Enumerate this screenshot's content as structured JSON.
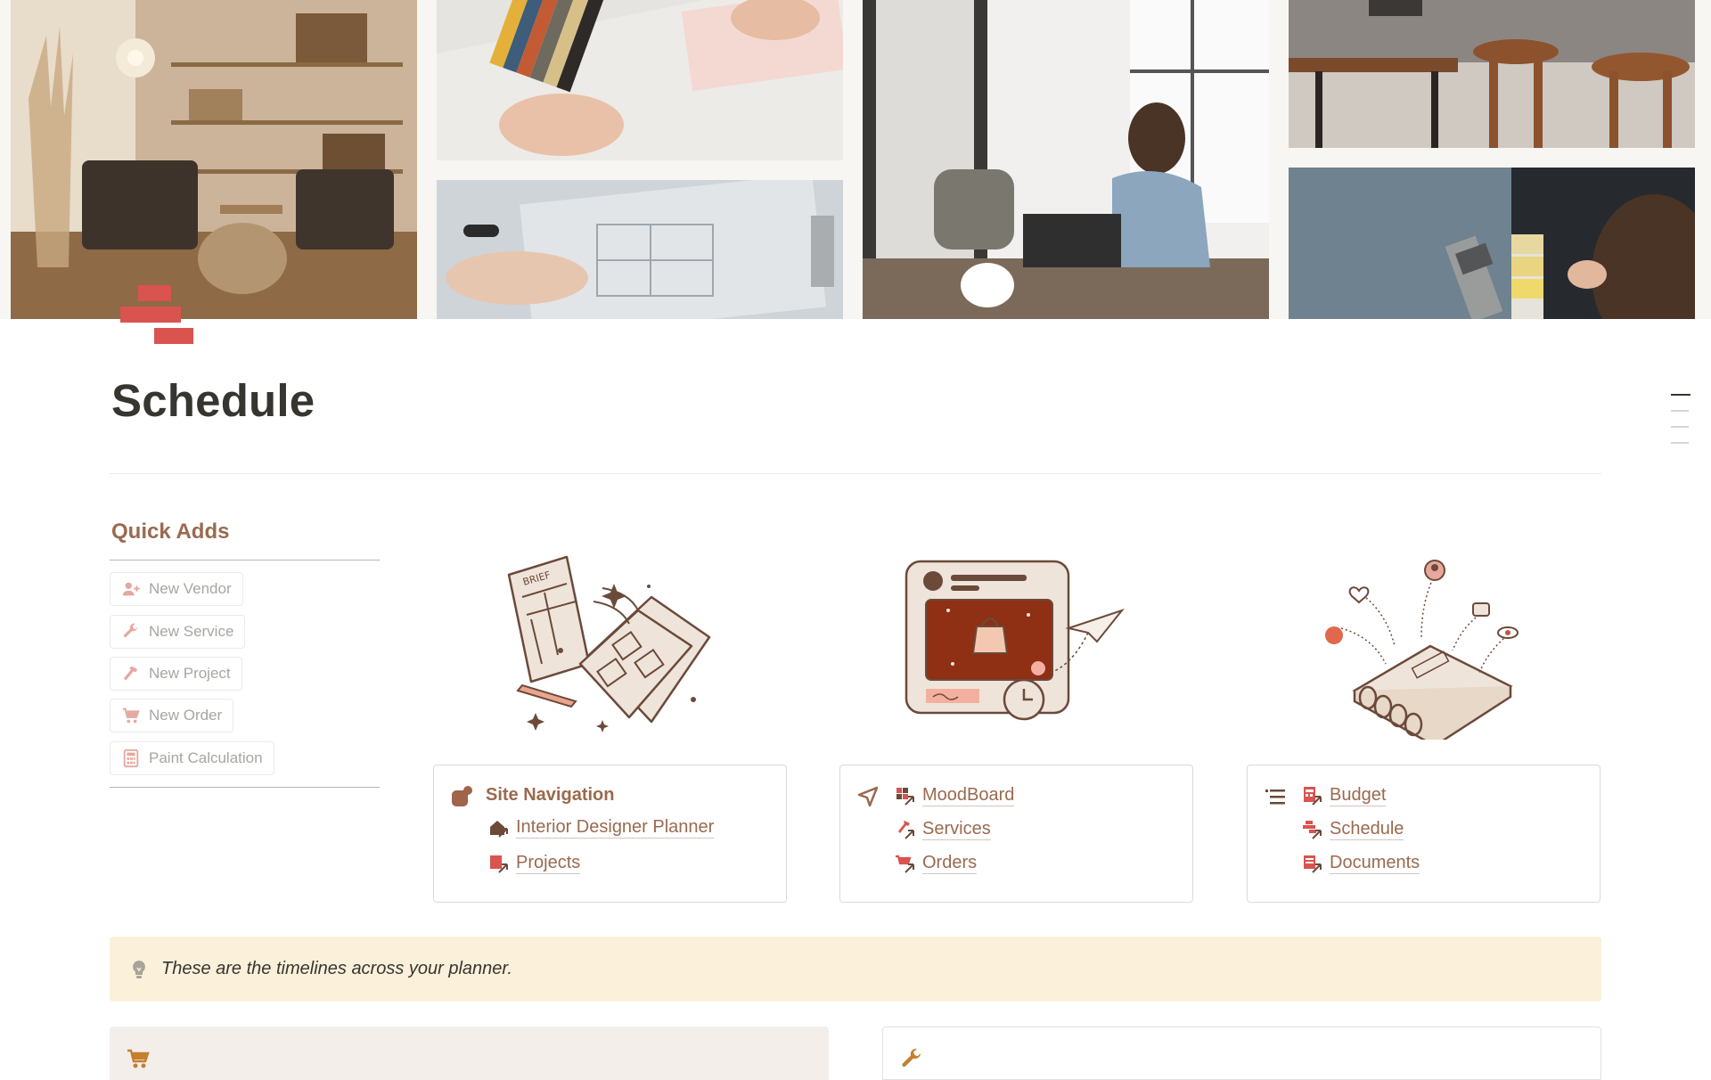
{
  "page": {
    "title": "Schedule"
  },
  "quick_adds": {
    "title": "Quick Adds",
    "buttons": [
      {
        "label": "New Vendor",
        "icon": "add-person-icon"
      },
      {
        "label": "New Service",
        "icon": "wrench-icon"
      },
      {
        "label": "New Project",
        "icon": "hammer-icon"
      },
      {
        "label": "New Order",
        "icon": "cart-icon"
      },
      {
        "label": "Paint Calculation",
        "icon": "calculator-icon"
      }
    ]
  },
  "nav_cards": [
    {
      "icon": "site-navigation-icon",
      "heading": "Site Navigation",
      "links": [
        {
          "label": "Interior Designer Planner",
          "icon": "house-link-icon"
        },
        {
          "label": "Projects",
          "icon": "projects-link-icon"
        }
      ]
    },
    {
      "icon": "paper-plane-icon",
      "links": [
        {
          "label": "MoodBoard",
          "icon": "moodboard-link-icon"
        },
        {
          "label": "Services",
          "icon": "services-link-icon"
        },
        {
          "label": "Orders",
          "icon": "orders-link-icon"
        }
      ]
    },
    {
      "icon": "list-icon",
      "links": [
        {
          "label": "Budget",
          "icon": "budget-link-icon"
        },
        {
          "label": "Schedule",
          "icon": "schedule-link-icon"
        },
        {
          "label": "Documents",
          "icon": "documents-link-icon"
        }
      ]
    }
  ],
  "callout": {
    "icon": "lightbulb-icon",
    "text": "These are the timelines across your planner."
  },
  "bottom_views": [
    {
      "icon": "cart-icon"
    },
    {
      "icon": "wrench-icon"
    }
  ],
  "colors": {
    "accent_brown": "#9a6a4f",
    "accent_red": "#d9534f",
    "callout_bg": "#fbf1db",
    "text": "#37352f"
  }
}
